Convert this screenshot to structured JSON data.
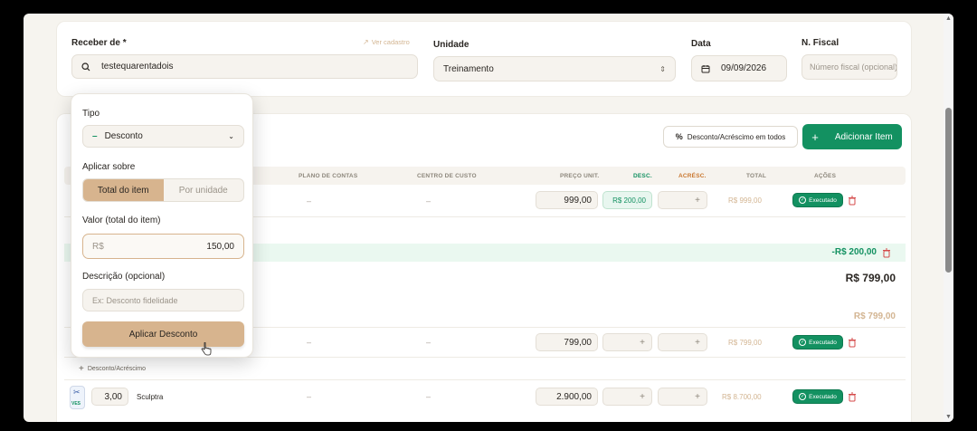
{
  "header": {
    "receber_label": "Receber de *",
    "ver_cadastro": "Ver cadastro",
    "receber_value": "testequarentadois",
    "unidade_label": "Unidade",
    "unidade_value": "Treinamento",
    "data_label": "Data",
    "data_value": "09/09/2026",
    "fiscal_label": "N. Fiscal",
    "fiscal_placeholder": "Número fiscal (opcional)"
  },
  "toolbar": {
    "desconto_todos": "Desconto/Acréscimo em todos",
    "adicionar_item": "Adicionar Item"
  },
  "table": {
    "headers": {
      "plano": "PLANO DE CONTAS",
      "centro": "CENTRO DE CUSTO",
      "preco": "PREÇO UNIT.",
      "desc": "DESC.",
      "acresc": "ACRÉSC.",
      "total": "TOTAL",
      "acoes": "AÇÕES"
    },
    "row1": {
      "plano": "–",
      "centro": "–",
      "preco": "999,00",
      "desc": "R$ 200,00",
      "acresc": "+",
      "total": "R$ 999,00",
      "status": "Executado"
    },
    "discount_line": {
      "value": "-R$ 200,00"
    },
    "subtotal": {
      "value": "R$ 799,00"
    },
    "subtotal_muted": {
      "value": "R$ 799,00"
    },
    "row2": {
      "plano": "–",
      "centro": "–",
      "preco": "799,00",
      "desc": "+",
      "acresc": "+",
      "total": "R$ 799,00",
      "status": "Executado"
    },
    "add_discount_link": "Desconto/Acréscimo",
    "row3": {
      "qty": "3,00",
      "name": "Sculptra",
      "unit_tag": "VES",
      "plano": "–",
      "centro": "–",
      "preco": "2.900,00",
      "desc": "+",
      "acresc": "+",
      "total": "R$ 8.700,00",
      "status": "Executado"
    }
  },
  "popover": {
    "tipo_label": "Tipo",
    "tipo_value": "Desconto",
    "aplicar_label": "Aplicar sobre",
    "seg_total": "Total do item",
    "seg_unidade": "Por unidade",
    "valor_label": "Valor (total do item)",
    "valor_prefix": "R$",
    "valor_value": "150,00",
    "descricao_label": "Descrição (opcional)",
    "descricao_placeholder": "Ex: Desconto fidelidade",
    "apply_button": "Aplicar Desconto"
  },
  "colors": {
    "accent": "#d7b48e",
    "green": "#139161",
    "danger": "#d44a4a"
  }
}
